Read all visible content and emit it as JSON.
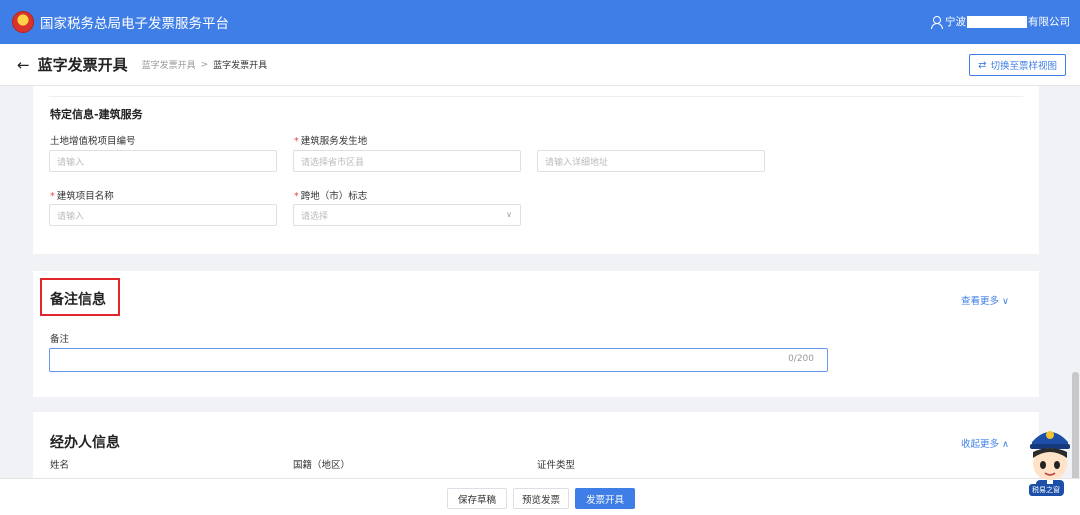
{
  "header": {
    "app_title": "国家税务总局电子发票服务平台",
    "user_prefix": "宁波",
    "user_suffix": "有限公司",
    "brand_color": "#3f7ee6"
  },
  "subheader": {
    "back_icon": "←",
    "title": "蓝字发票开具",
    "breadcrumb": [
      "蓝字发票开具",
      "蓝字发票开具"
    ],
    "breadcrumb_sep": ">",
    "switch_label": "切换至票样视图"
  },
  "construction": {
    "section_label": "特定信息-建筑服务",
    "land_vat_label": "土地增值税项目编号",
    "land_vat_placeholder": "请输入",
    "location_label": "建筑服务发生地",
    "location_placeholder": "请选择省市区县",
    "address_placeholder": "请输入详细地址",
    "project_label": "建筑项目名称",
    "project_placeholder": "请输入",
    "cross_region_label": "跨地（市）标志",
    "cross_region_placeholder": "请选择",
    "required_mark": "*"
  },
  "remark": {
    "title": "备注信息",
    "more": "查看更多",
    "field_label": "备注",
    "counter": "0/200"
  },
  "handler": {
    "title": "经办人信息",
    "collapse": "收起更多",
    "name_label": "姓名",
    "nationality_label": "国籍（地区）",
    "id_type_label": "证件类型"
  },
  "footer": {
    "save_draft": "保存草稿",
    "preview": "预览发票",
    "issue": "发票开具"
  },
  "mascot": {
    "badge": "税易之窗"
  }
}
